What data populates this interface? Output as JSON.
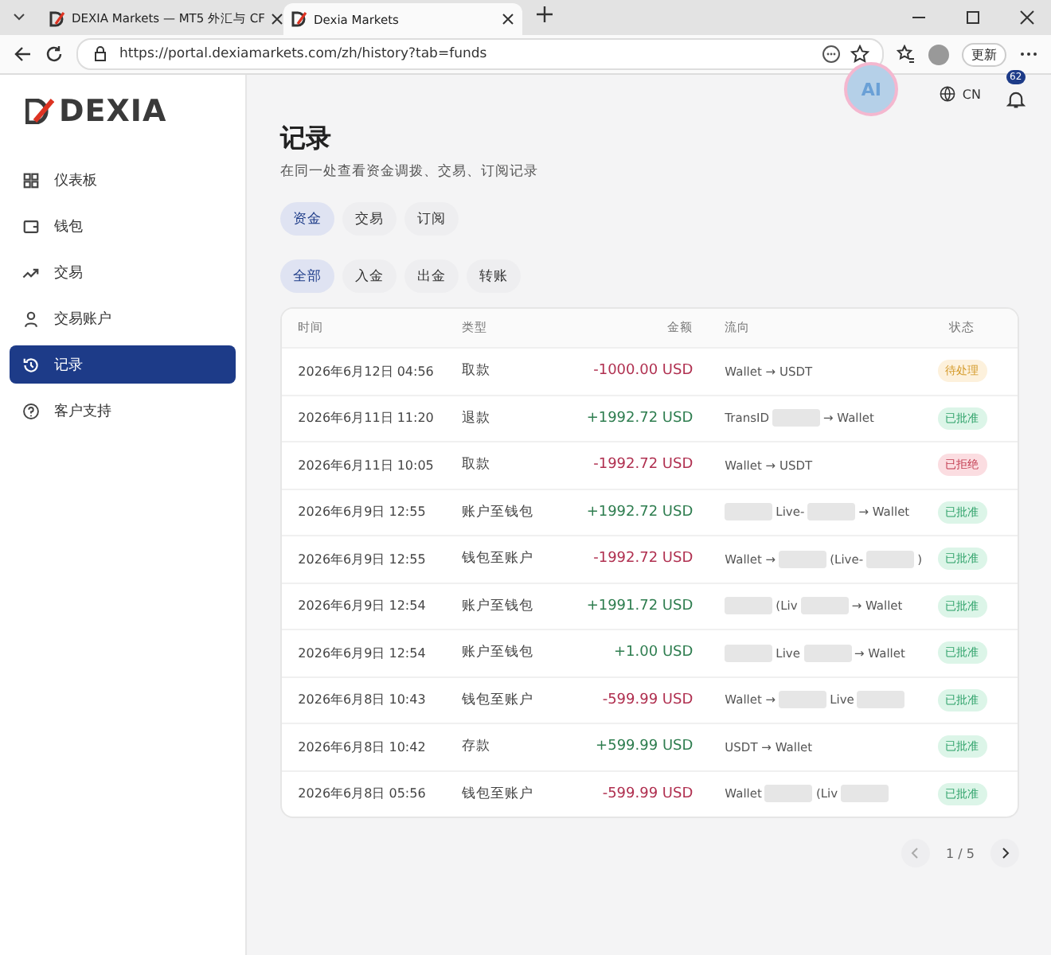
{
  "browser": {
    "tabs": [
      {
        "title": "DEXIA Markets — MT5 外汇与 CF",
        "selected": false
      },
      {
        "title": "Dexia Markets",
        "selected": true
      }
    ],
    "url": "https://portal.dexiamarkets.com/zh/history?tab=funds",
    "update_label": "更新"
  },
  "brand": {
    "logo": "DEXIA"
  },
  "topbar": {
    "ai_label": "AI",
    "language": "CN",
    "notifications": "62"
  },
  "sidebar": {
    "items": [
      {
        "label": "仪表板",
        "selected": false
      },
      {
        "label": "钱包",
        "selected": false
      },
      {
        "label": "交易",
        "selected": false
      },
      {
        "label": "交易账户",
        "selected": false
      },
      {
        "label": "记录",
        "selected": true
      },
      {
        "label": "客户支持",
        "selected": false
      }
    ]
  },
  "page": {
    "title": "记录",
    "subtitle": "在同一处查看资金调拨、交易、订阅记录"
  },
  "tabs": [
    {
      "label": "资金",
      "selected": true
    },
    {
      "label": "交易",
      "selected": false
    },
    {
      "label": "订阅",
      "selected": false
    }
  ],
  "filters": [
    {
      "label": "全部",
      "selected": true
    },
    {
      "label": "入金",
      "selected": false
    },
    {
      "label": "出金",
      "selected": false
    },
    {
      "label": "转账",
      "selected": false
    }
  ],
  "table": {
    "columns": [
      "时间",
      "类型",
      "金额",
      "流向",
      "状态"
    ],
    "rows": [
      {
        "time": "2026年6月12日 04:56",
        "type": "取款",
        "amount": {
          "text": "-1000.00 USD",
          "kind": "debit"
        },
        "flow": [
          {
            "kind": "text",
            "text": "Wallet → USDT"
          }
        ],
        "status": {
          "text": "待处理",
          "kind": "pending"
        }
      },
      {
        "time": "2026年6月11日 11:20",
        "type": "退款",
        "amount": {
          "text": "+1992.72 USD",
          "kind": "credit"
        },
        "flow": [
          {
            "kind": "text",
            "text": "TransID"
          },
          {
            "kind": "blur"
          },
          {
            "kind": "text",
            "text": "→ Wallet"
          }
        ],
        "status": {
          "text": "已批准",
          "kind": "approved"
        }
      },
      {
        "time": "2026年6月11日 10:05",
        "type": "取款",
        "amount": {
          "text": "-1992.72 USD",
          "kind": "debit"
        },
        "flow": [
          {
            "kind": "text",
            "text": "Wallet → USDT"
          }
        ],
        "status": {
          "text": "已拒绝",
          "kind": "rejected"
        }
      },
      {
        "time": "2026年6月9日 12:55",
        "type": "账户至钱包",
        "amount": {
          "text": "+1992.72 USD",
          "kind": "credit"
        },
        "flow": [
          {
            "kind": "blur"
          },
          {
            "kind": "text",
            "text": "Live-"
          },
          {
            "kind": "blur"
          },
          {
            "kind": "text",
            "text": "→ Wallet"
          }
        ],
        "status": {
          "text": "已批准",
          "kind": "approved"
        }
      },
      {
        "time": "2026年6月9日 12:55",
        "type": "钱包至账户",
        "amount": {
          "text": "-1992.72 USD",
          "kind": "debit"
        },
        "flow": [
          {
            "kind": "text",
            "text": "Wallet →"
          },
          {
            "kind": "blur"
          },
          {
            "kind": "text",
            "text": "(Live-"
          },
          {
            "kind": "blur"
          },
          {
            "kind": "text",
            "text": ")"
          }
        ],
        "status": {
          "text": "已批准",
          "kind": "approved"
        }
      },
      {
        "time": "2026年6月9日 12:54",
        "type": "账户至钱包",
        "amount": {
          "text": "+1991.72 USD",
          "kind": "credit"
        },
        "flow": [
          {
            "kind": "blur"
          },
          {
            "kind": "text",
            "text": "(Liv"
          },
          {
            "kind": "blur"
          },
          {
            "kind": "text",
            "text": "→ Wallet"
          }
        ],
        "status": {
          "text": "已批准",
          "kind": "approved"
        }
      },
      {
        "time": "2026年6月9日 12:54",
        "type": "账户至钱包",
        "amount": {
          "text": "+1.00 USD",
          "kind": "credit"
        },
        "flow": [
          {
            "kind": "blur"
          },
          {
            "kind": "text",
            "text": "Live"
          },
          {
            "kind": "blur"
          },
          {
            "kind": "text",
            "text": "→ Wallet"
          }
        ],
        "status": {
          "text": "已批准",
          "kind": "approved"
        }
      },
      {
        "time": "2026年6月8日 10:43",
        "type": "钱包至账户",
        "amount": {
          "text": "-599.99 USD",
          "kind": "debit"
        },
        "flow": [
          {
            "kind": "text",
            "text": "Wallet →"
          },
          {
            "kind": "blur"
          },
          {
            "kind": "text",
            "text": "Live"
          },
          {
            "kind": "blur"
          }
        ],
        "status": {
          "text": "已批准",
          "kind": "approved"
        }
      },
      {
        "time": "2026年6月8日 10:42",
        "type": "存款",
        "amount": {
          "text": "+599.99 USD",
          "kind": "credit"
        },
        "flow": [
          {
            "kind": "text",
            "text": "USDT → Wallet"
          }
        ],
        "status": {
          "text": "已批准",
          "kind": "approved"
        }
      },
      {
        "time": "2026年6月8日 05:56",
        "type": "钱包至账户",
        "amount": {
          "text": "-599.99 USD",
          "kind": "debit"
        },
        "flow": [
          {
            "kind": "text",
            "text": "Wallet"
          },
          {
            "kind": "blur"
          },
          {
            "kind": "text",
            "text": "(Liv"
          },
          {
            "kind": "blur"
          }
        ],
        "status": {
          "text": "已批准",
          "kind": "approved"
        }
      }
    ]
  },
  "pagination": {
    "page": "1 / 5"
  }
}
